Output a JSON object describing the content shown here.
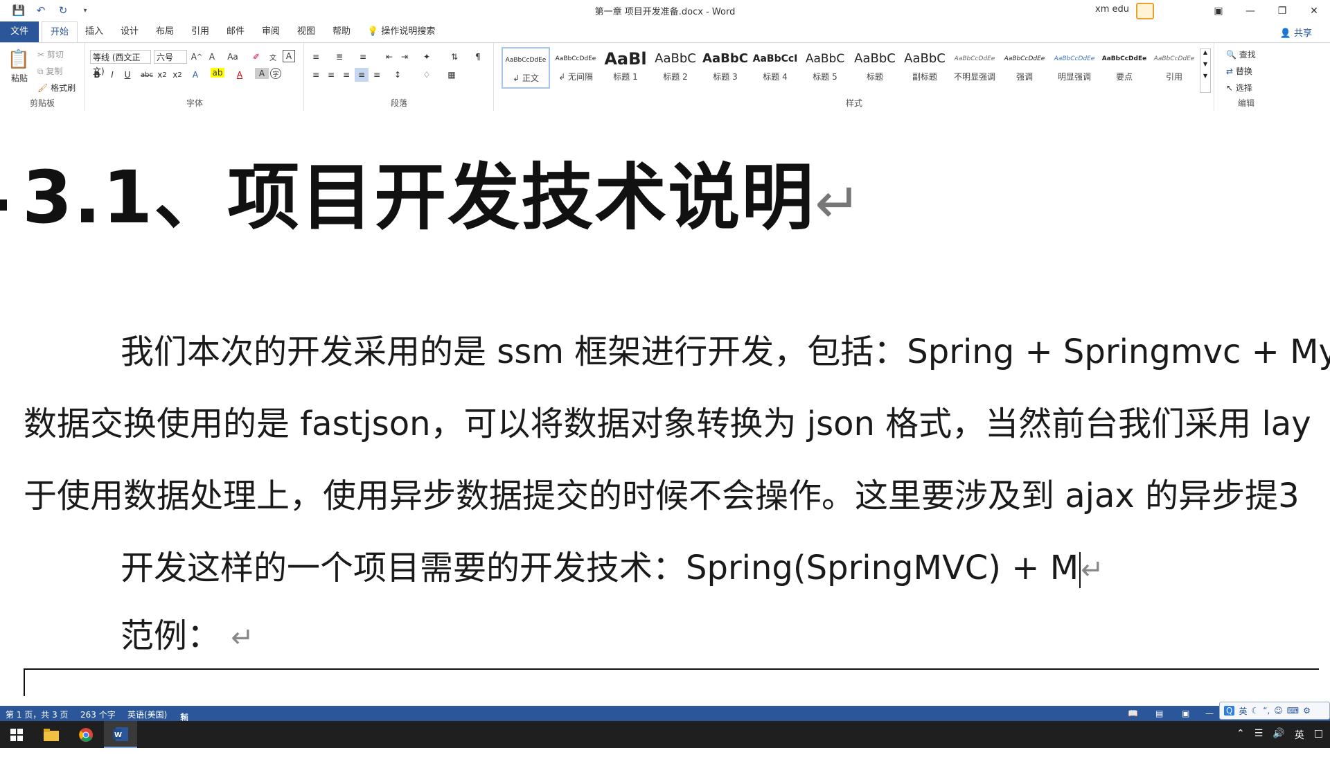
{
  "window": {
    "title": "第一章 项目开发准备.docx  -  Word",
    "user": "xm edu"
  },
  "qat": {
    "save_icon": "save-icon",
    "undo_icon": "undo-icon",
    "redo_icon": "redo-icon"
  },
  "tabs": [
    "文件",
    "开始",
    "插入",
    "设计",
    "布局",
    "引用",
    "邮件",
    "审阅",
    "视图",
    "帮助"
  ],
  "tell_me": "操作说明搜索",
  "share": "共享",
  "ribbon": {
    "clipboard": {
      "paste": "粘贴",
      "cut": "剪切",
      "copy": "复制",
      "format_painter": "格式刷",
      "label": "剪贴板"
    },
    "font": {
      "family": "等线 (西文正文)",
      "size": "六号",
      "label": "字体"
    },
    "paragraph": {
      "label": "段落"
    },
    "styles": {
      "label": "样式",
      "items": [
        {
          "preview": "AaBbCcDdEe",
          "name": "↲ 正文"
        },
        {
          "preview": "AaBbCcDdEe",
          "name": "↲ 无间隔"
        },
        {
          "preview": "AaBl",
          "name": "标题 1"
        },
        {
          "preview": "AaBbC",
          "name": "标题 2"
        },
        {
          "preview": "AaBbC",
          "name": "标题 3"
        },
        {
          "preview": "AaBbCcI",
          "name": "标题 4"
        },
        {
          "preview": "AaBbC",
          "name": "标题 5"
        },
        {
          "preview": "AaBbC",
          "name": "标题"
        },
        {
          "preview": "AaBbC",
          "name": "副标题"
        },
        {
          "preview": "AaBbCcDdEe",
          "name": "不明显强调"
        },
        {
          "preview": "AaBbCcDdEe",
          "name": "强调"
        },
        {
          "preview": "AaBbCcDdEe",
          "name": "明显强调"
        },
        {
          "preview": "AaBbCcDdEe",
          "name": "要点"
        },
        {
          "preview": "AaBbCcDdEe",
          "name": "引用"
        }
      ]
    },
    "editing": {
      "find": "查找",
      "replace": "替换",
      "select": "选择",
      "label": "编辑"
    }
  },
  "document": {
    "heading": "3.1、项目开发技术说明",
    "para1_line1": "我们本次的开发采用的是 ssm 框架进行开发，包括：Spring + Springmvc + MyI",
    "para1_line2": "数据交换使用的是 fastjson，可以将数据对象转换为 json 格式，当然前台我们采用 lay",
    "para1_line3": "于使用数据处理上，使用异步数据提交的时候不会操作。这里要涉及到 ajax 的异步提3",
    "para2": "开发这样的一个项目需要的开发技术：Spring(SpringMVC) + M",
    "para3": "范例：",
    "return_mark": "↵"
  },
  "status": {
    "page": "第 1 页，共 3 页",
    "words": "263 个字",
    "language": "英语(美国)",
    "accessibility": "辅助功能: 调查"
  },
  "ime": {
    "mode": "英"
  },
  "taskbar": {
    "lang": "英"
  }
}
